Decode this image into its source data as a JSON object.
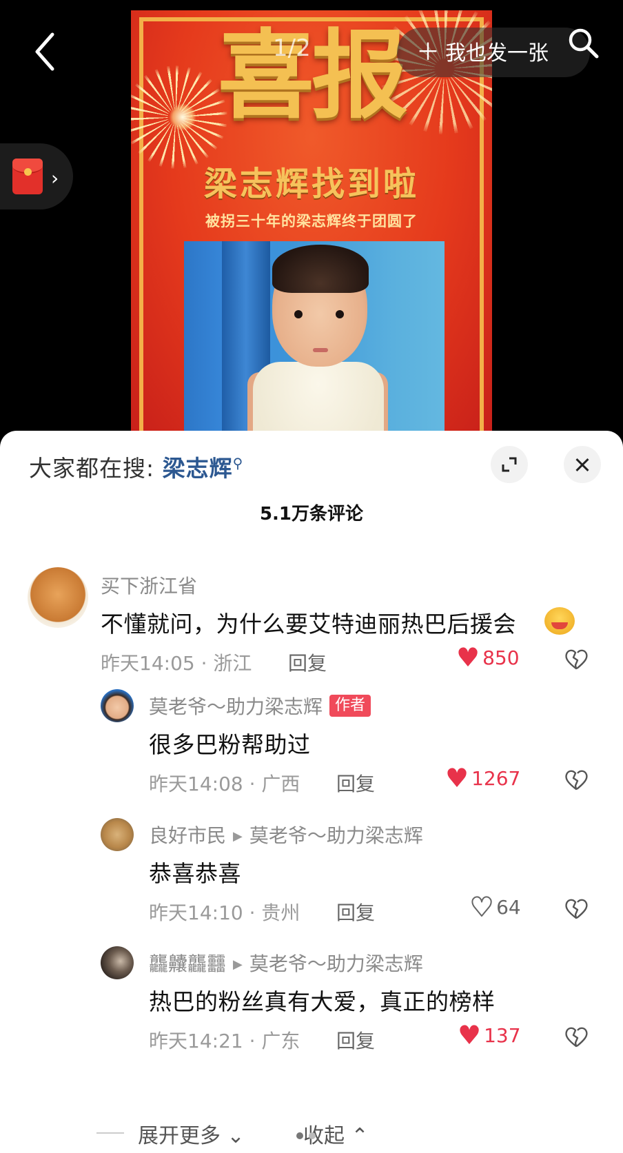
{
  "viewer": {
    "pager": "1/2",
    "post_button": "我也发一张",
    "poster": {
      "title": "喜报",
      "subtitle": "梁志辉找到啦",
      "line": "被拐三十年的梁志辉终于团圆了"
    }
  },
  "comments_panel": {
    "search_prefix": "大家都在搜:",
    "search_keyword": "梁志辉",
    "count": "5.1万条评论",
    "comments": [
      {
        "user": "买下浙江省",
        "text": "不懂就问，为什么要艾特迪丽热巴后援会",
        "time": "昨天14:05",
        "location": "浙江",
        "reply": "回复",
        "likes": "850",
        "liked": true
      },
      {
        "user": "莫老爷～助力梁志辉",
        "tag": "作者",
        "text": "很多巴粉帮助过",
        "time": "昨天14:08",
        "location": "广西",
        "reply": "回复",
        "likes": "1267",
        "liked": true
      },
      {
        "user": "良好市民",
        "reply_to": "莫老爷～助力梁志辉",
        "text": "恭喜恭喜",
        "time": "昨天14:10",
        "location": "贵州",
        "reply": "回复",
        "likes": "64",
        "liked": false
      },
      {
        "user": "龘齉龘䨻",
        "reply_to": "莫老爷～助力梁志辉",
        "text": "热巴的粉丝真有大爱，真正的榜样",
        "time": "昨天14:21",
        "location": "广东",
        "reply": "回复",
        "likes": "137",
        "liked": true
      }
    ],
    "expand_more": "展开更多",
    "collapse": "收起"
  },
  "colors": {
    "like_red": "#e8324a",
    "keyword_blue": "#2c5891",
    "author_tag": "#f04a5a"
  },
  "icons": [
    "back-arrow-icon",
    "search-icon",
    "red-envelope-icon",
    "expand-icon",
    "close-icon",
    "heart-icon",
    "broken-heart-icon",
    "chevron-down-icon",
    "chevron-up-icon"
  ]
}
